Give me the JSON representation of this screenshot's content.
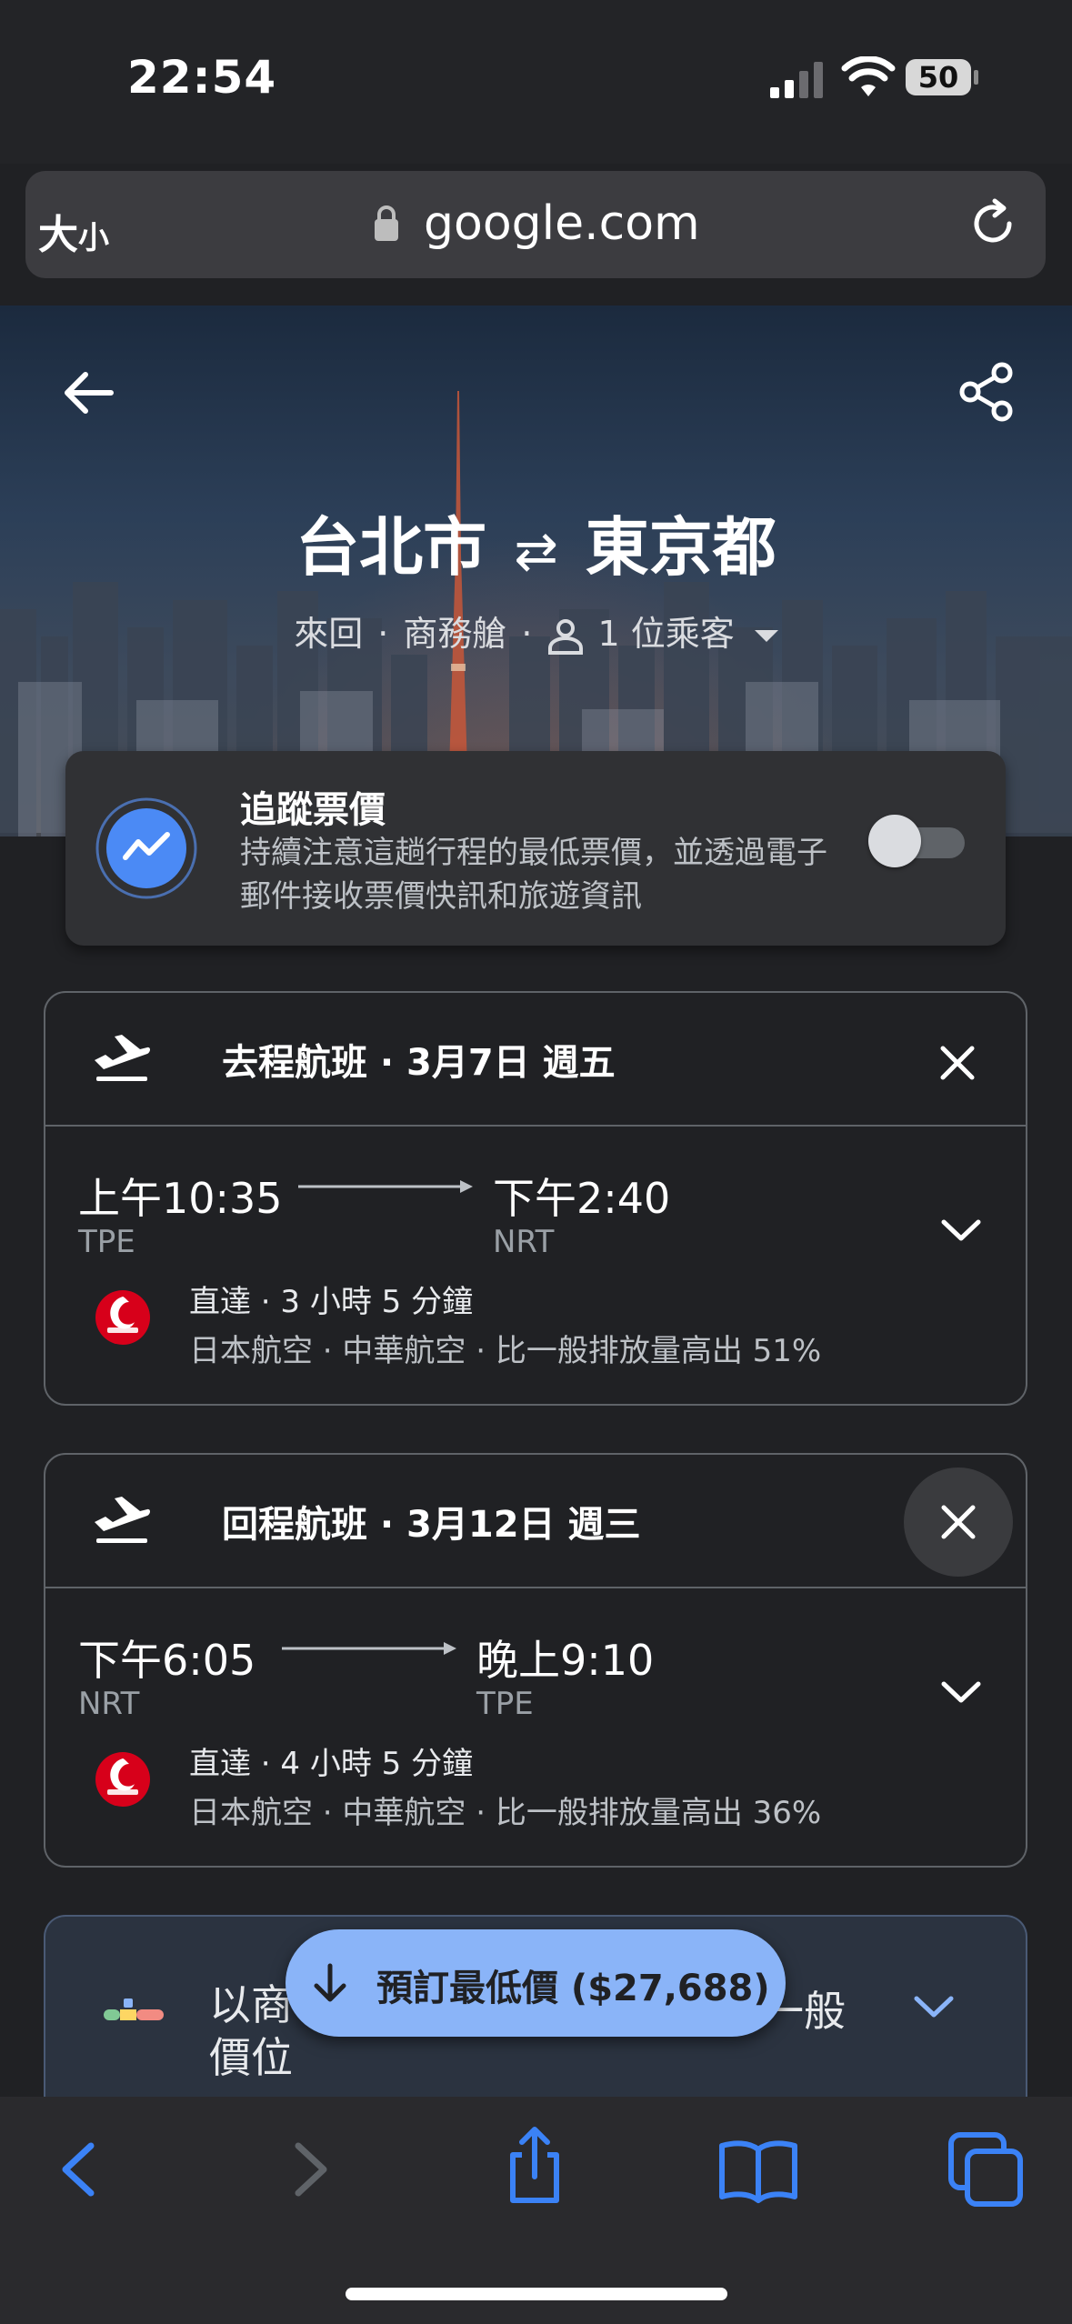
{
  "status": {
    "time": "22:54",
    "battery": "50"
  },
  "browser": {
    "text_size_label": "大",
    "text_size_small": "小",
    "domain": "google.com"
  },
  "header": {
    "origin": "台北市",
    "destination": "東京都",
    "trip_type": "來回",
    "cabin": "商務艙",
    "passengers": "1 位乘客"
  },
  "tracking": {
    "title": "追蹤票價",
    "description": "持續注意這趟行程的最低票價，並透過電子郵件接收票價快訊和旅遊資訊",
    "enabled": false
  },
  "flights": [
    {
      "heading": "去程航班 · 3月7日 週五",
      "depart_time": "上午10:35",
      "depart_code": "TPE",
      "arrive_time": "下午2:40",
      "arrive_code": "NRT",
      "summary": "直達 · 3 小時 5 分鐘",
      "details": "日本航空 · 中華航空 · 比一般排放量高出 51%"
    },
    {
      "heading": "回程航班 · 3月12日 週三",
      "depart_time": "下午6:05",
      "depart_code": "NRT",
      "arrive_time": "晚上9:10",
      "arrive_code": "TPE",
      "summary": "直達 · 4 小時 5 分鐘",
      "details": "日本航空 · 中華航空 · 比一般排放量高出 36%"
    }
  ],
  "info_card": {
    "line1": "以商",
    "line1_end": "一般",
    "line2": "價位"
  },
  "book_button": {
    "label": "預訂最低價 ($27,688)"
  },
  "colors": {
    "accent": "#8ab4f8",
    "background": "#202124",
    "card": "#303134",
    "airline_red": "#d7001a",
    "toolbar_icon": "#3b82f6"
  }
}
